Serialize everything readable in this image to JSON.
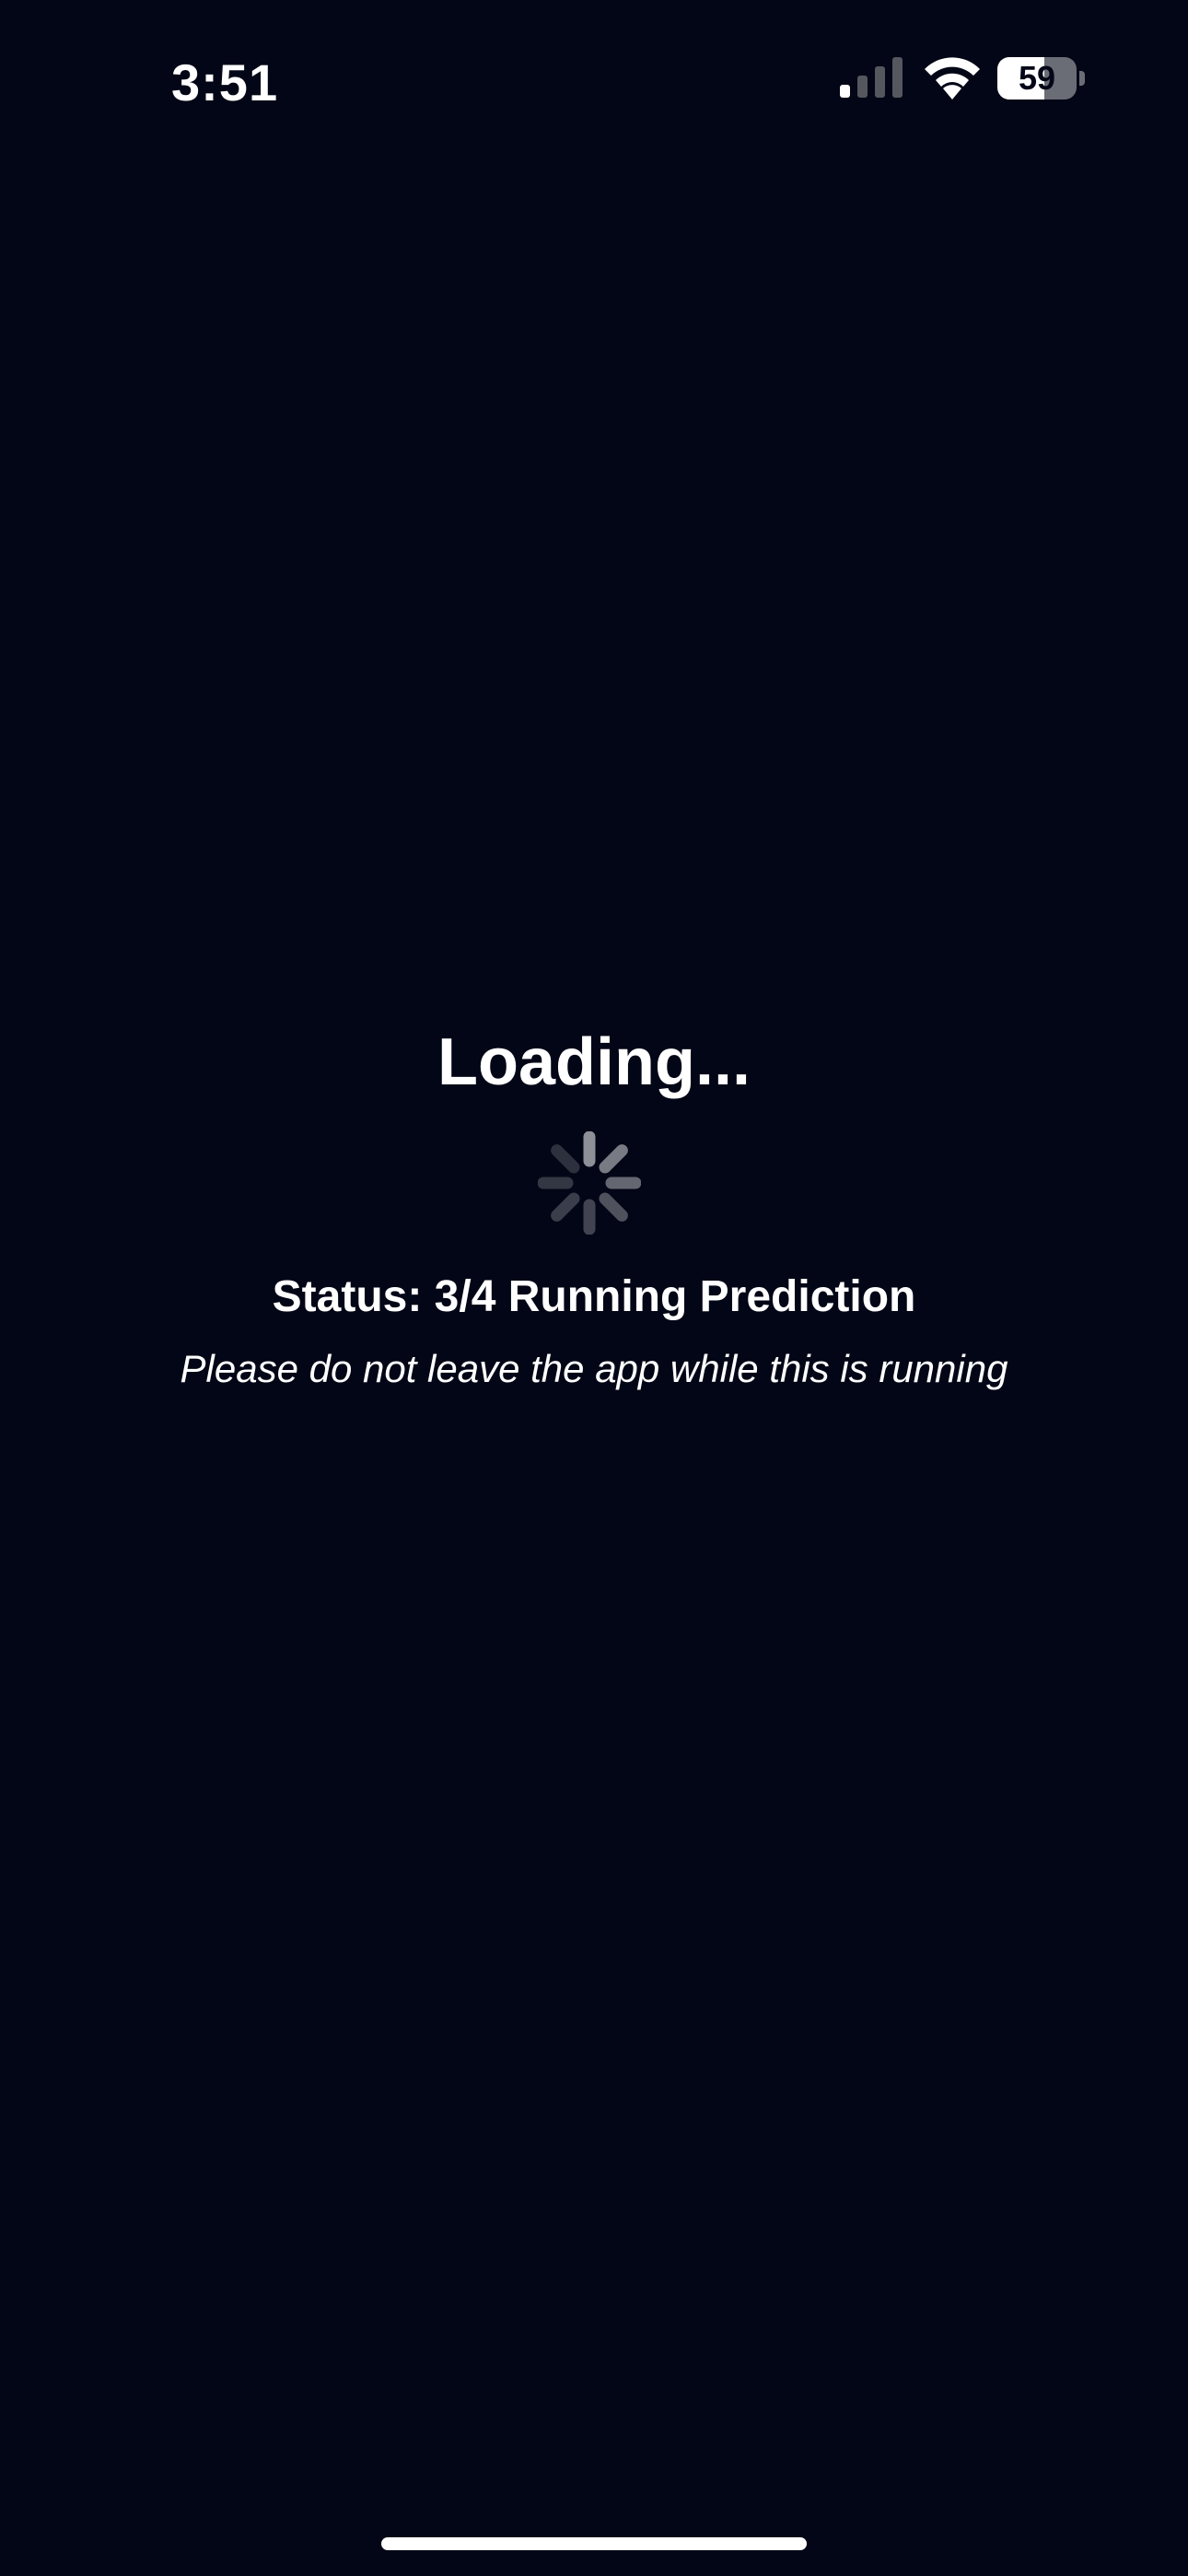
{
  "status_bar": {
    "time": "3:51",
    "signal_icon": "cellular-signal-icon",
    "wifi_icon": "wifi-icon",
    "battery_percent": "59",
    "battery_level": 0.59
  },
  "main": {
    "title": "Loading...",
    "spinner_icon": "activity-spinner-icon",
    "status": "Status: 3/4 Running Prediction",
    "warning": "Please do not leave the app while this is running"
  },
  "colors": {
    "background": "#030616",
    "text": "#ffffff",
    "spinner": "#8e9098"
  }
}
